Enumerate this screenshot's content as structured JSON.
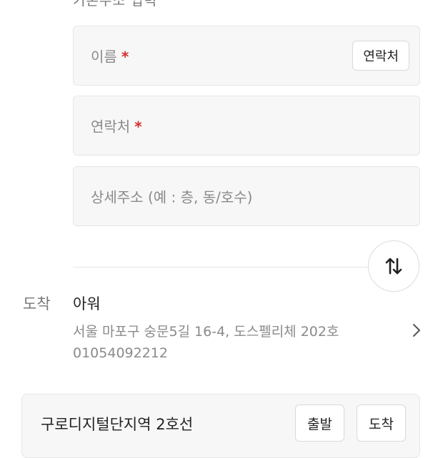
{
  "form": {
    "top_partial_text": "기본주소 입력",
    "name": {
      "placeholder": "이름",
      "required_mark": "*",
      "contact_button": "연락처"
    },
    "phone": {
      "placeholder": "연락처",
      "required_mark": "*"
    },
    "detail": {
      "placeholder": "상세주소 (예 : 층, 동/호수)"
    }
  },
  "swap": {
    "icon": "swap-vertical-icon"
  },
  "destination": {
    "label": "도착",
    "name": "아워",
    "address": "서울 마포구 숭문5길 16-4, 도스펠리체 202호",
    "phone": "01054092212"
  },
  "station": {
    "name": "구로디지털단지역 2호선",
    "depart_label": "출발",
    "arrive_label": "도착"
  },
  "colors": {
    "required": "#d32f2f",
    "field_bg": "#f7f7f7"
  }
}
